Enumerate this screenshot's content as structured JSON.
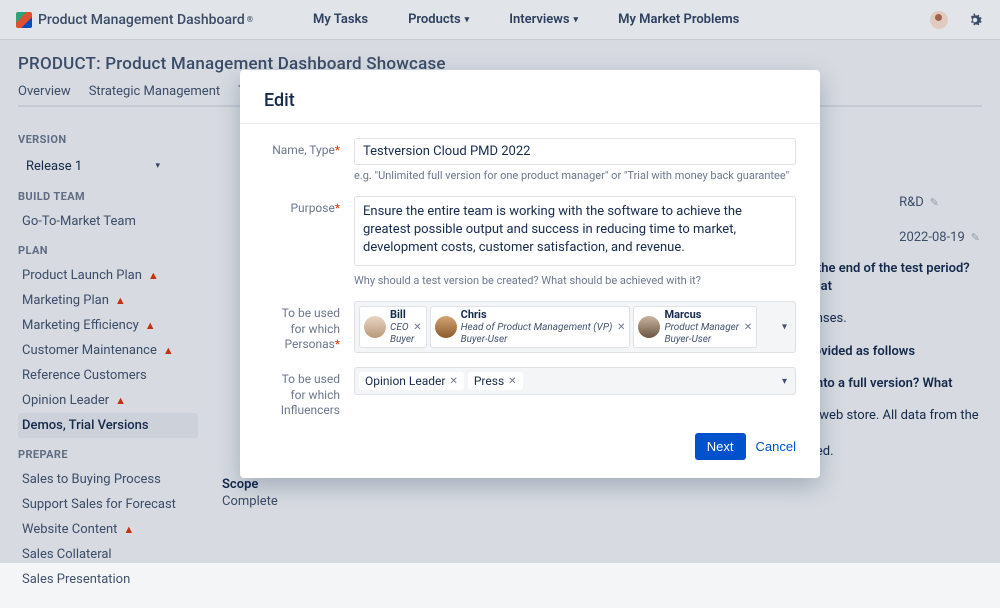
{
  "brand": "Product Management Dashboard",
  "brand_reg": "®",
  "topnav": {
    "items": [
      "My Tasks",
      "Products",
      "Interviews",
      "My Market Problems"
    ],
    "has_dropdown": [
      false,
      true,
      true,
      false
    ]
  },
  "page": {
    "title": "PRODUCT: Product Management Dashboard Showcase",
    "tabs": [
      "Overview",
      "Strategic Management",
      "Te"
    ]
  },
  "sidebar": {
    "version_label": "VERSION",
    "version_value": "Release 1",
    "groups": [
      {
        "header": "BUILD TEAM",
        "items": [
          {
            "label": "Go-To-Market Team",
            "warn": false
          }
        ]
      },
      {
        "header": "PLAN",
        "items": [
          {
            "label": "Product Launch Plan",
            "warn": true
          },
          {
            "label": "Marketing Plan",
            "warn": true
          },
          {
            "label": "Marketing Efficiency",
            "warn": true
          },
          {
            "label": "Customer Maintenance",
            "warn": true
          },
          {
            "label": "Reference Customers",
            "warn": false
          },
          {
            "label": "Opinion Leader",
            "warn": true
          },
          {
            "label": "Demos, Trial Versions",
            "warn": false,
            "active": true
          }
        ]
      },
      {
        "header": "PREPARE",
        "items": [
          {
            "label": "Sales to Buying Process",
            "warn": false
          },
          {
            "label": "Support Sales for Forecast",
            "warn": false
          },
          {
            "label": "Website Content",
            "warn": true
          },
          {
            "label": "Sales Collateral",
            "warn": false
          },
          {
            "label": "Sales Presentation",
            "warn": false
          }
        ]
      }
    ]
  },
  "content": {
    "scope_label": "Scope",
    "scope_value": "Complete"
  },
  "right_meta": {
    "dept": "R&D",
    "date": "2022-08-19"
  },
  "right_fragments": [
    "er the end of the test period? What",
    "censes.",
    "provided as follows",
    "d into a full version? What",
    "he web store. All data from the",
    "used."
  ],
  "modal": {
    "title": "Edit",
    "labels": {
      "name_type": "Name, Type",
      "purpose": "Purpose",
      "personas": "To be used for which Personas",
      "influencers": "To be used for which Influencers"
    },
    "name_type_value": "Testversion Cloud PMD 2022",
    "name_type_hint": "e.g. \"Unlimited full version for one product manager\" or \"Trial with money back guarantee\"",
    "purpose_value": "Ensure the entire team is working with the software to achieve the greatest possible output and success in reducing time to market, development costs, customer satisfaction, and revenue.",
    "purpose_hint": "Why should a test version be created? What should be achieved with it?",
    "personas": [
      {
        "name": "Bill",
        "title": "CEO",
        "role": "Buyer"
      },
      {
        "name": "Chris",
        "title": "Head of Product Management (VP)",
        "role": "Buyer-User"
      },
      {
        "name": "Marcus",
        "title": "Product Manager",
        "role": "Buyer-User"
      }
    ],
    "influencers": [
      "Opinion Leader",
      "Press"
    ],
    "buttons": {
      "next": "Next",
      "cancel": "Cancel"
    }
  }
}
